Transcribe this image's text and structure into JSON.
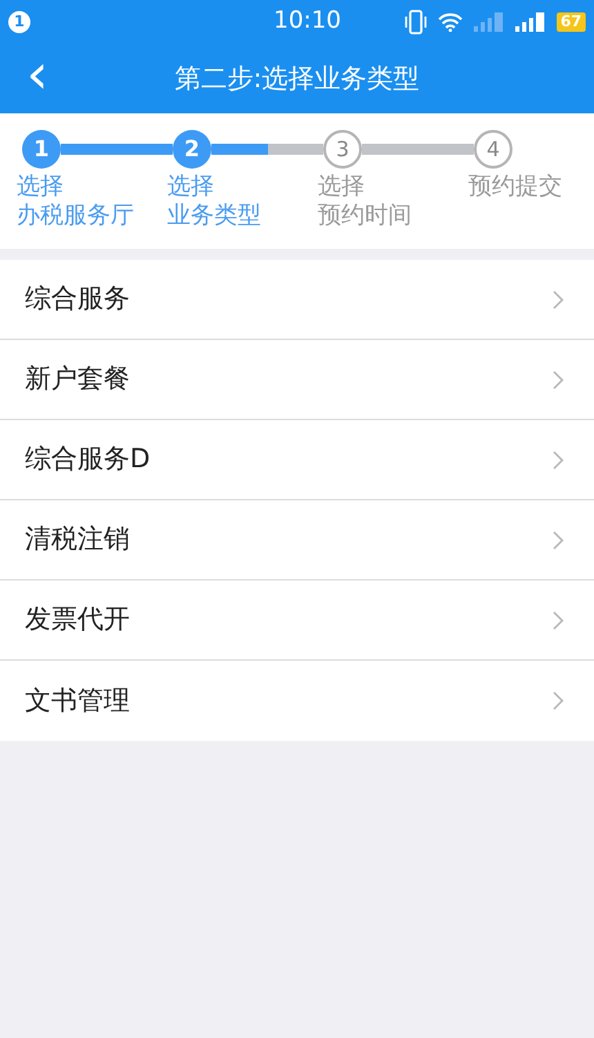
{
  "status_bar": {
    "notification_count": "1",
    "time": "10:10",
    "battery": "67"
  },
  "nav_bar": {
    "back": "‹",
    "title": "第二步:选择业务类型"
  },
  "stepper": {
    "steps": [
      {
        "number": "1",
        "lines": [
          "选择",
          "办税服务厅"
        ],
        "done": true,
        "level": 1
      },
      {
        "number": "2",
        "lines": [
          "选择",
          "业务类型"
        ],
        "done": true,
        "level": 0.5
      },
      {
        "number": "3",
        "lines": [
          "选择",
          "预约时间"
        ],
        "done": false,
        "level": 0
      },
      {
        "number": "4",
        "lines": [
          "预约提交"
        ],
        "done": false
      }
    ]
  },
  "services": [
    {
      "label": "综合服务"
    },
    {
      "label": "新户套餐"
    },
    {
      "label": "综合服务D"
    },
    {
      "label": "清税注销"
    },
    {
      "label": "发票代开"
    },
    {
      "label": "文书管理"
    }
  ]
}
